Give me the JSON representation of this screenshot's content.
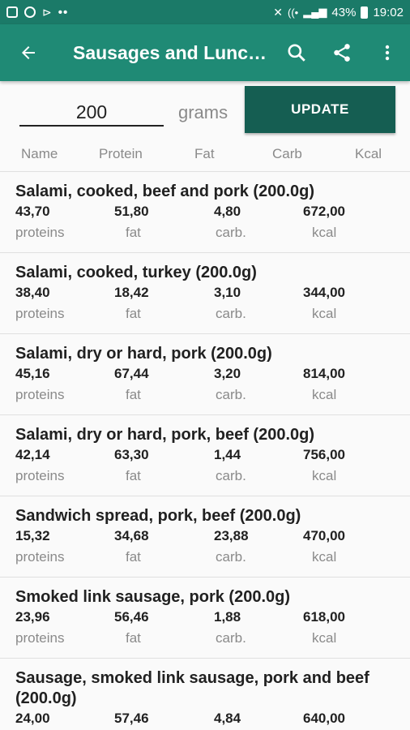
{
  "status": {
    "battery": "43%",
    "time": "19:02"
  },
  "app_bar": {
    "title": "Sausages and Lunc…"
  },
  "form": {
    "grams_value": "200",
    "grams_label": "grams",
    "update_label": "UPDATE"
  },
  "columns": [
    "Name",
    "Protein",
    "Fat",
    "Carb",
    "Kcal"
  ],
  "units": {
    "protein": "proteins",
    "fat": "fat",
    "carb": "carb.",
    "kcal": "kcal"
  },
  "items": [
    {
      "name": "Salami, cooked, beef and pork (200.0g)",
      "protein": "43,70",
      "fat": "51,80",
      "carb": "4,80",
      "kcal": "672,00"
    },
    {
      "name": "Salami, cooked, turkey (200.0g)",
      "protein": "38,40",
      "fat": "18,42",
      "carb": "3,10",
      "kcal": "344,00"
    },
    {
      "name": "Salami, dry or hard, pork (200.0g)",
      "protein": "45,16",
      "fat": "67,44",
      "carb": "3,20",
      "kcal": "814,00"
    },
    {
      "name": "Salami, dry or hard, pork, beef (200.0g)",
      "protein": "42,14",
      "fat": "63,30",
      "carb": "1,44",
      "kcal": "756,00"
    },
    {
      "name": "Sandwich spread, pork, beef (200.0g)",
      "protein": "15,32",
      "fat": "34,68",
      "carb": "23,88",
      "kcal": "470,00"
    },
    {
      "name": "Smoked link sausage, pork (200.0g)",
      "protein": "23,96",
      "fat": "56,46",
      "carb": "1,88",
      "kcal": "618,00"
    },
    {
      "name": "Sausage, smoked link sausage, pork and beef (200.0g)",
      "protein": "24,00",
      "fat": "57,46",
      "carb": "4,84",
      "kcal": "640,00"
    }
  ],
  "colors": {
    "status_bar": "#1b7a68",
    "app_bar": "#1f8a75",
    "update_button": "#155e52"
  }
}
